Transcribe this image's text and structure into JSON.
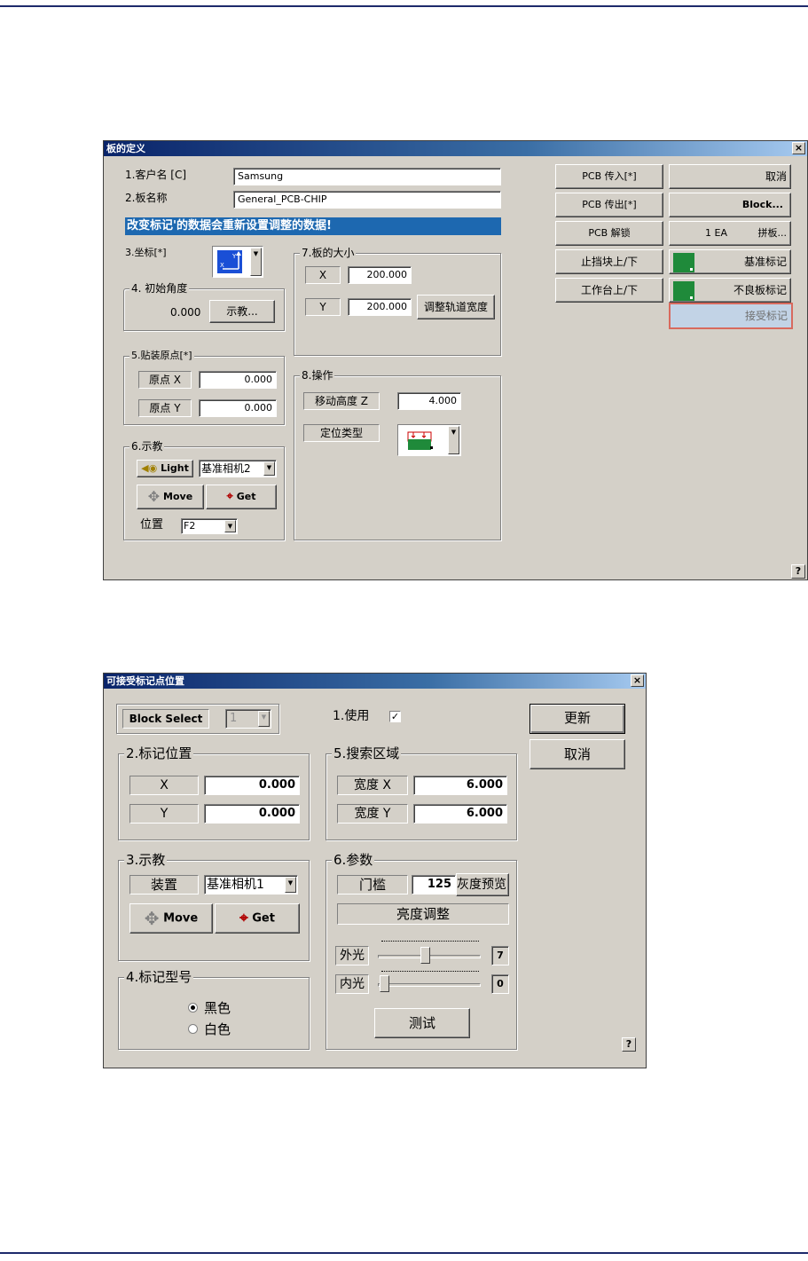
{
  "dialog1": {
    "title": "板的定义",
    "customer_label": "1.客户名 [C]",
    "customer_value": "Samsung",
    "board_label": "2.板名称",
    "board_value": "General_PCB-CHIP",
    "warning": "改变标记'的数据会重新设置调整的数据!",
    "coord_label": "3.坐标[*]",
    "angle_group": "4. 初始角度",
    "angle_value": "0.000",
    "teach_btn": "示教...",
    "origin_group": "5.贴装原点[*]",
    "origin_x_label": "原点 X",
    "origin_x_value": "0.000",
    "origin_y_label": "原点 Y",
    "origin_y_value": "0.000",
    "teach_group": "6.示教",
    "light_btn": "Light",
    "camera_value": "基准相机2",
    "move_btn": "Move",
    "get_btn": "Get",
    "pos_label": "位置",
    "pos_value": "F2",
    "size_group": "7.板的大小",
    "x_label": "X",
    "x_value": "200.000",
    "y_label": "Y",
    "y_value": "200.000",
    "adjust_btn": "调整轨道宽度",
    "op_group": "8.操作",
    "move_z_label": "移动高度 Z",
    "move_z_value": "4.000",
    "locate_label": "定位类型",
    "buttons": {
      "pcb_in": "PCB 传入[*]",
      "cancel": "取消",
      "pcb_out": "PCB 传出[*]",
      "block": "Block...",
      "pcb_unlock": "PCB 解锁",
      "ea": "1 EA",
      "panel": "拼板...",
      "stopper": "止挡块上/下",
      "fiducial": "基准标记",
      "table": "工作台上/下",
      "bad_mark": "不良板标记",
      "accept_mark": "接受标记"
    },
    "help": "?"
  },
  "dialog2": {
    "title": "可接受标记点位置",
    "block_select_label": "Block Select",
    "block_select_value": "1",
    "use_label": "1.使用",
    "update_btn": "更新",
    "cancel_btn": "取消",
    "mark_pos_group": "2.标记位置",
    "x_label": "X",
    "x_value": "0.000",
    "y_label": "Y",
    "y_value": "0.000",
    "search_group": "5.搜索区域",
    "width_x_label": "宽度 X",
    "width_x_value": "6.000",
    "width_y_label": "宽度 Y",
    "width_y_value": "6.000",
    "teach_group": "3.示教",
    "device_label": "装置",
    "device_value": "基准相机1",
    "move_btn": "Move",
    "get_btn": "Get",
    "param_group": "6.参数",
    "threshold_label": "门槛",
    "threshold_value": "125",
    "preview_btn": "灰度预览",
    "brightness_btn": "亮度调整",
    "outer_label": "外光",
    "outer_value": "7",
    "inner_label": "内光",
    "inner_value": "0",
    "test_btn": "测试",
    "mark_type_group": "4.标记型号",
    "black_label": "黑色",
    "white_label": "白色",
    "help": "?"
  }
}
